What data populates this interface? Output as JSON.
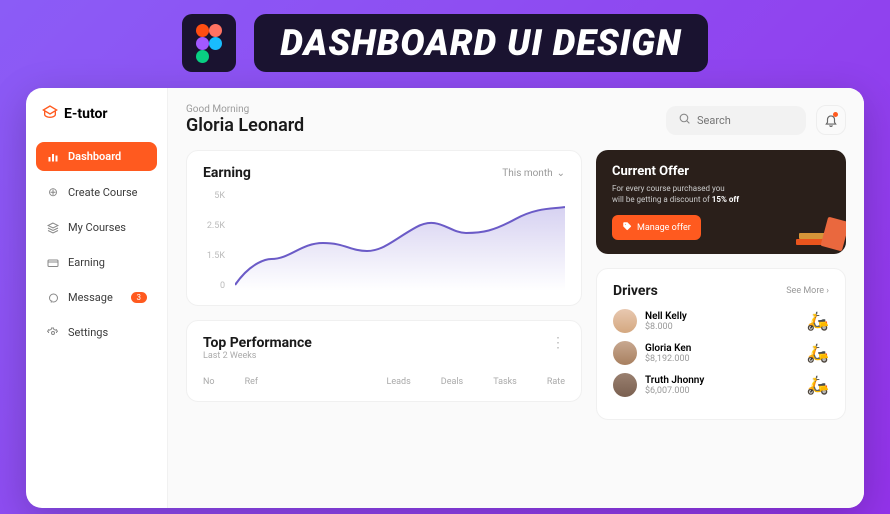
{
  "banner": {
    "title": "DASHBOARD UI DESIGN"
  },
  "brand": {
    "name": "E-tutor"
  },
  "sidebar": {
    "items": [
      {
        "label": "Dashboard",
        "active": true
      },
      {
        "label": "Create Course"
      },
      {
        "label": "My Courses"
      },
      {
        "label": "Earning"
      },
      {
        "label": "Message",
        "badge": "3"
      },
      {
        "label": "Settings"
      }
    ]
  },
  "header": {
    "greeting": "Good Morning",
    "name": "Gloria Leonard",
    "search_placeholder": "Search"
  },
  "earning": {
    "title": "Earning",
    "period": "This month"
  },
  "chart_data": {
    "type": "area",
    "title": "Earning",
    "ylabel": "",
    "ylim": [
      0,
      5
    ],
    "yticks": [
      "5K",
      "2.5K",
      "1.5K",
      "0"
    ],
    "x": [
      0,
      1,
      2,
      3,
      4,
      5,
      6,
      7,
      8,
      9
    ],
    "values": [
      0.3,
      1.6,
      2.4,
      2.0,
      2.6,
      3.2,
      2.9,
      3.0,
      3.6,
      4.2
    ]
  },
  "offer": {
    "title": "Current Offer",
    "text_a": "For every course purchased you",
    "text_b": "will be getting a discount of ",
    "highlight": "15% off",
    "button": "Manage offer"
  },
  "drivers": {
    "title": "Drivers",
    "seemore": "See More",
    "list": [
      {
        "name": "Nell Kelly",
        "amount": "$8.000",
        "color": "#3b5bff"
      },
      {
        "name": "Gloria Ken",
        "amount": "$8,192.000",
        "color": "#d92b2b"
      },
      {
        "name": "Truth Jhonny",
        "amount": "$6,007.000",
        "color": "#c9b89a"
      }
    ]
  },
  "performance": {
    "title": "Top Performance",
    "subtitle": "Last 2 Weeks",
    "columns": [
      "No",
      "Ref",
      "Leads",
      "Deals",
      "Tasks",
      "Rate"
    ]
  }
}
